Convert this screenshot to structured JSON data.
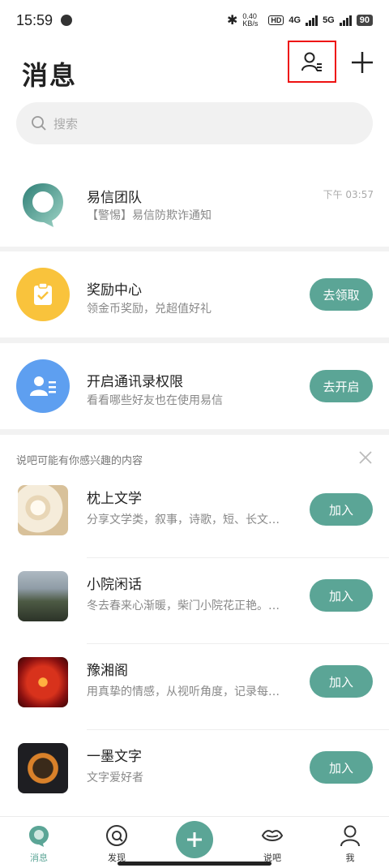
{
  "status": {
    "time": "15:59",
    "speed": "0.40 KB/s",
    "net1": "4G",
    "net2": "5G",
    "battery": "90"
  },
  "header": {
    "title": "消息"
  },
  "search": {
    "placeholder": "搜索"
  },
  "conversations": [
    {
      "title": "易信团队",
      "subtitle": "【警惕】易信防欺诈通知",
      "time": "下午 03:57"
    }
  ],
  "promos": [
    {
      "title": "奖励中心",
      "subtitle": "领金币奖励，兑超值好礼",
      "action": "去领取",
      "color": "#f9c33c"
    },
    {
      "title": "开启通讯录权限",
      "subtitle": "看看哪些好友也在使用易信",
      "action": "去开启",
      "color": "#5e9ff0"
    }
  ],
  "recommend": {
    "heading": "说吧可能有你感兴趣的内容",
    "items": [
      {
        "title": "枕上文学",
        "subtitle": "分享文学类，叙事，诗歌，短、长文…",
        "action": "加入"
      },
      {
        "title": "小院闲话",
        "subtitle": "冬去春来心渐暖，柴门小院花正艳。…",
        "action": "加入"
      },
      {
        "title": "豫湘阁",
        "subtitle": "用真挚的情感，从视听角度，记录每…",
        "action": "加入"
      },
      {
        "title": "一墨文字",
        "subtitle": "文字爱好者",
        "action": "加入"
      }
    ]
  },
  "tabs": [
    {
      "label": "消息"
    },
    {
      "label": "发现"
    },
    {
      "label": "说吧"
    },
    {
      "label": "我"
    }
  ],
  "colors": {
    "accent": "#5ba596",
    "highlight": "#ee1111"
  }
}
